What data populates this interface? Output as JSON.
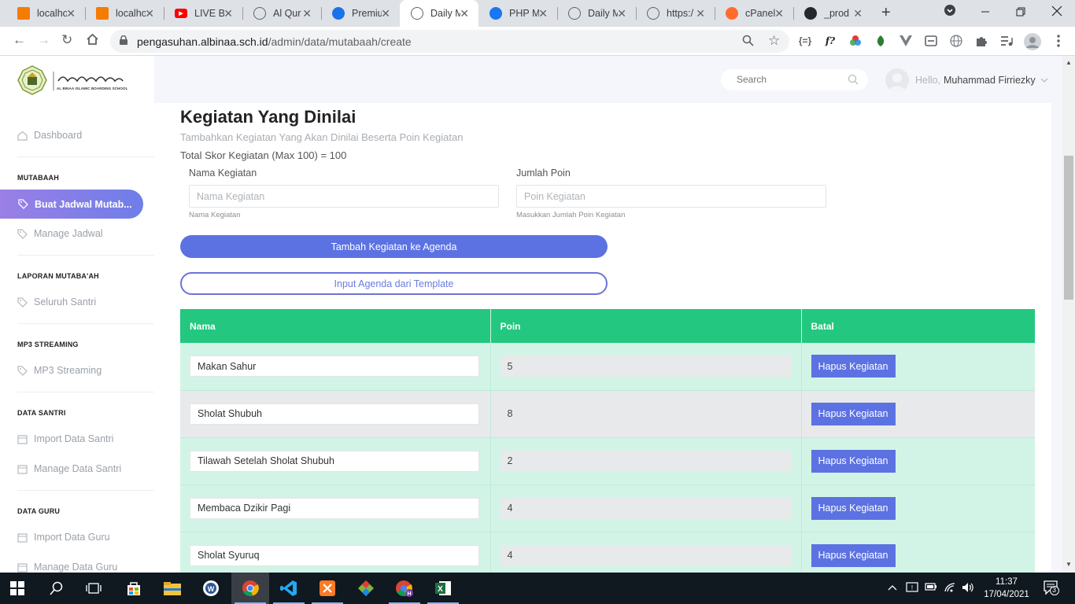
{
  "browser": {
    "tabs": [
      {
        "label": "localho",
        "favicon": "xampp-icon",
        "color": "#f57c00"
      },
      {
        "label": "localho",
        "favicon": "xampp-icon",
        "color": "#f57c00"
      },
      {
        "label": "LIVE Bi",
        "favicon": "youtube-icon",
        "color": "#ff0000"
      },
      {
        "label": "Al Qur",
        "favicon": "globe-icon",
        "color": "#5f6368"
      },
      {
        "label": "Premiu",
        "favicon": "chart-icon",
        "color": "#1a73e8"
      },
      {
        "label": "Daily M",
        "favicon": "globe-icon",
        "color": "#5f6368",
        "active": true
      },
      {
        "label": "PHP M",
        "favicon": "facebook-icon",
        "color": "#1877f2"
      },
      {
        "label": "Daily M",
        "favicon": "globe-icon",
        "color": "#5f6368"
      },
      {
        "label": "https:/",
        "favicon": "globe-icon",
        "color": "#5f6368"
      },
      {
        "label": "cPanel",
        "favicon": "cpanel-icon",
        "color": "#ff6c2c"
      },
      {
        "label": "_prod",
        "favicon": "github-icon",
        "color": "#24292e"
      }
    ],
    "url_host": "pengasuhan.albinaa.sch.id",
    "url_path": "/admin/data/mutabaah/create"
  },
  "sidebar": {
    "logo_text": "AL BINAA ISLAMIC BOARDING SCHOOL",
    "dashboard": "Dashboard",
    "sections": [
      {
        "heading": "MUTABAAH",
        "items": [
          "Buat Jadwal Mutab...",
          "Manage Jadwal"
        ]
      },
      {
        "heading": "LAPORAN MUTABA'AH",
        "items": [
          "Seluruh Santri"
        ]
      },
      {
        "heading": "MP3 STREAMING",
        "items": [
          "MP3 Streaming"
        ]
      },
      {
        "heading": "DATA SANTRI",
        "items": [
          "Import Data Santri",
          "Manage Data Santri"
        ]
      },
      {
        "heading": "DATA GURU",
        "items": [
          "Import Data Guru",
          "Manage Data Guru"
        ]
      }
    ]
  },
  "header": {
    "search_placeholder": "Search",
    "hello": "Hello,",
    "username": "Muhammad Firriezky"
  },
  "main": {
    "title": "Kegiatan Yang Dinilai",
    "subtitle": "Tambahkan Kegiatan Yang Akan Dinilai Beserta Poin Kegiatan",
    "total": "Total Skor Kegiatan (Max 100) = 100",
    "nama_label": "Nama Kegiatan",
    "nama_placeholder": "Nama Kegiatan",
    "nama_help": "Nama Kegiatan",
    "poin_label": "Jumlah Poin",
    "poin_placeholder": "Poin Kegiatan",
    "poin_help": "Masukkan Jumlah Poin Kegiatan",
    "add_button": "Tambah Kegiatan ke Agenda",
    "template_button": "Input Agenda dari Template"
  },
  "table": {
    "headers": [
      "Nama",
      "Poin",
      "Batal"
    ],
    "delete_label": "Hapus Kegiatan",
    "rows": [
      {
        "nama": "Makan Sahur",
        "poin": "5"
      },
      {
        "nama": "Sholat Shubuh",
        "poin": "8"
      },
      {
        "nama": "Tilawah Setelah Sholat Shubuh",
        "poin": "2"
      },
      {
        "nama": "Membaca Dzikir Pagi",
        "poin": "4"
      },
      {
        "nama": "Sholat Syuruq",
        "poin": "4"
      }
    ]
  },
  "taskbar": {
    "time": "11:37",
    "date": "17/04/2021",
    "notifications": "3"
  },
  "colors": {
    "accent": "#5c72e2",
    "table_header": "#23c77f",
    "row_green": "#d2f4e6",
    "row_gray": "#e8e9ea"
  }
}
